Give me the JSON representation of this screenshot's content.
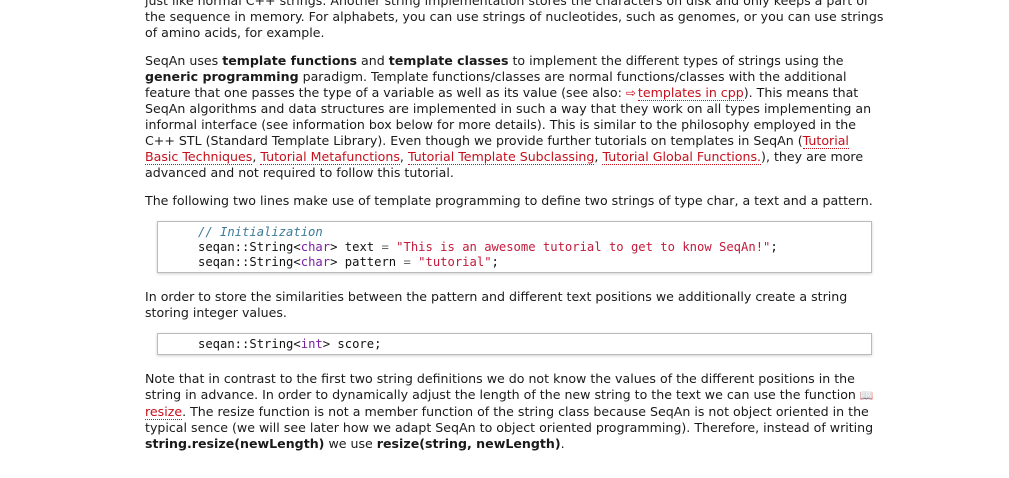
{
  "intro": {
    "text": "just like normal C++ strings. Another string implementation stores the characters on disk and only keeps a part of the sequence in memory. For alphabets, you can use strings of nucleotides, such as genomes, or you can use strings of amino acids, for example."
  },
  "templates": {
    "t1": "SeqAn uses ",
    "b1": "template functions",
    "t2": " and ",
    "b2": "template classes",
    "t3": " to implement the different types of strings using the ",
    "b3": "generic programming",
    "t4": " paradigm. Template functions/classes are normal functions/classes with the additional feature that one passes the type of a variable as well as its value (see also: ",
    "link_cpp": "templates in cpp",
    "t5": "). This means that SeqAn algorithms and data structures are implemented in such a way that they work on all types implementing an informal interface (see information box below for more details). This is similar to the philosophy employed in the C++ STL (Standard Template Library). Even though we provide further tutorials on templates in SeqAn (",
    "link_basic": "Tutorial Basic Techniques",
    "sep1": ", ",
    "link_meta": "Tutorial Metafunctions",
    "sep2": ", ",
    "link_subclass": "Tutorial Template Subclassing",
    "sep3": ", ",
    "link_global": "Tutorial Global Functions.",
    "t6": "), they are more advanced and not required to follow this tutorial."
  },
  "lines_para": {
    "text": "The following two lines make use of template programming to define two strings of type char, a text and a pattern."
  },
  "code1": {
    "comment": "// Initialization",
    "l1_ns": "seqan::String<",
    "l1_type": "char",
    "l1_mid": "> text ",
    "l1_eq": "=",
    "l1_sp": " ",
    "l1_str": "\"This is an awesome tutorial to get to know SeqAn!\"",
    "l1_end": ";",
    "l2_ns": "seqan::String<",
    "l2_type": "char",
    "l2_mid": "> pattern ",
    "l2_eq": "=",
    "l2_sp": " ",
    "l2_str": "\"tutorial\"",
    "l2_end": ";"
  },
  "similarity_para": {
    "text": "In order to store the similarities between the pattern and different text positions we additionally create a string storing integer values."
  },
  "code2": {
    "ns": "seqan::String<",
    "type": "int",
    "rest": "> score;"
  },
  "resize_para": {
    "t1": "Note that in contrast to the first two string definitions we do not know the values of the different positions in the string in advance. In order to dynamically adjust the length of the new string to the text we can use the function ",
    "link_resize": "resize",
    "t2": ". The resize function is not a member function of the string class because SeqAn is not object oriented in the typical sence (we will see later how we adapt SeqAn to object oriented programming). Therefore, instead of writing ",
    "b1": "string.resize(newLength)",
    "t3": " we use ",
    "b2": "resize(string, newLength)",
    "t4": "."
  },
  "icons": {
    "external": "external-link-icon",
    "doc": "documentation-book-icon"
  },
  "colors": {
    "link": "#c60f1b",
    "comment": "#3d7a99",
    "keyword": "#7a1fa2",
    "string": "#c4193b"
  }
}
